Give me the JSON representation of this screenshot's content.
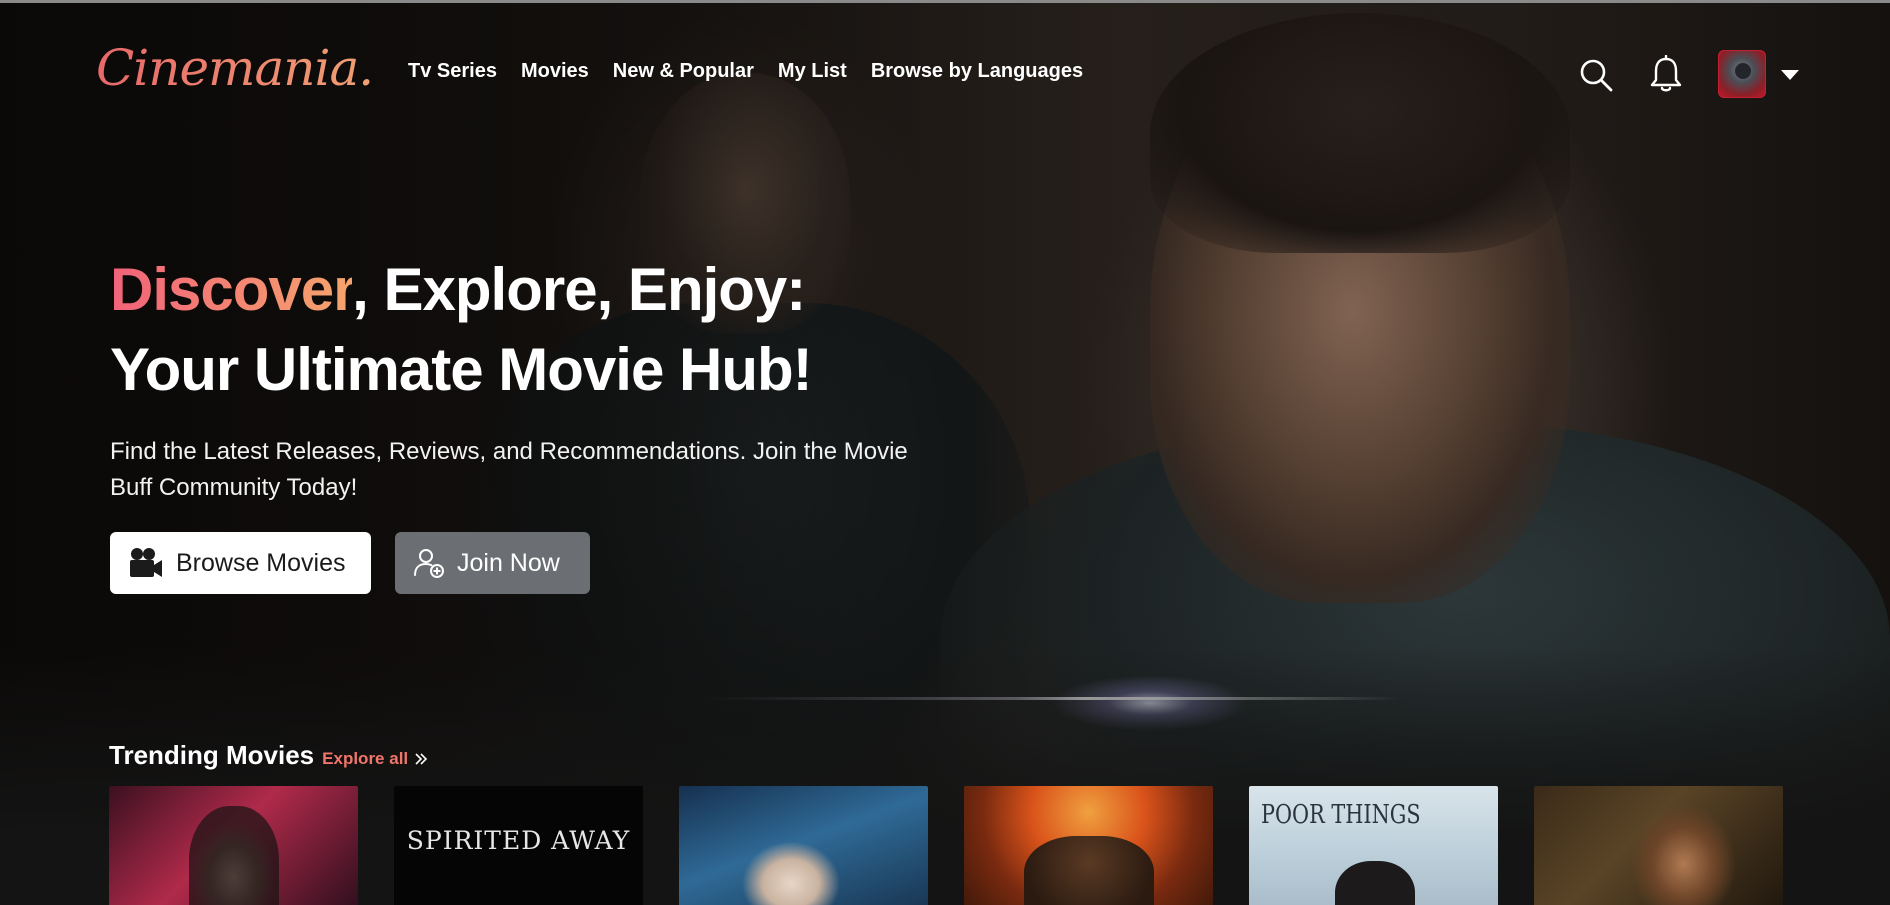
{
  "brand": {
    "logo_text": "Cinemania."
  },
  "nav": {
    "items": [
      {
        "label": "Tv Series"
      },
      {
        "label": "Movies"
      },
      {
        "label": "New & Popular"
      },
      {
        "label": "My List"
      },
      {
        "label": "Browse by Languages"
      }
    ],
    "icons": {
      "search": "search-icon",
      "notifications": "bell-icon",
      "profile_menu": "caret-down-icon"
    }
  },
  "hero": {
    "headline_accent": "Discover",
    "headline_rest": ", Explore, Enjoy:",
    "headline_line2": "Your Ultimate Movie Hub!",
    "subtitle": "Find the Latest Releases, Reviews, and Recommendations. Join the Movie Buff Community Today!",
    "primary_button": {
      "label": "Browse Movies",
      "icon": "video-camera-icon"
    },
    "secondary_button": {
      "label": "Join Now",
      "icon": "user-add-icon"
    }
  },
  "trending": {
    "title": "Trending Movies",
    "explore_label": "Explore all",
    "posters": [
      {
        "title_text": ""
      },
      {
        "title_text": "SPIRITED AWAY"
      },
      {
        "title_text": ""
      },
      {
        "title_text": ""
      },
      {
        "title_text": "POOR THINGS"
      },
      {
        "title_text": ""
      }
    ]
  },
  "colors": {
    "accent_start": "#f2627a",
    "accent_end": "#f5a56c",
    "primary_button_bg": "#ffffff",
    "secondary_button_bg": "#6b6e72",
    "page_bg": "#141414"
  }
}
